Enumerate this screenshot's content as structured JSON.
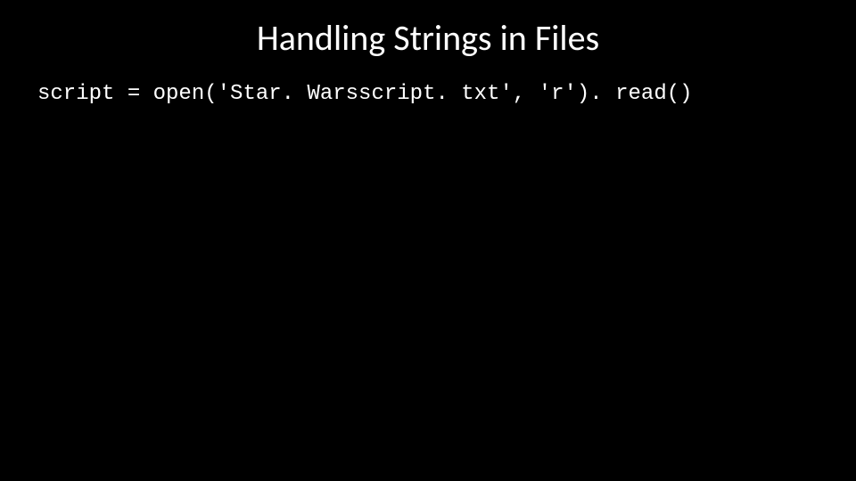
{
  "slide": {
    "title": "Handling Strings in Files",
    "code_line": "script = open('Star. Warsscript. txt', 'r'). read()"
  }
}
